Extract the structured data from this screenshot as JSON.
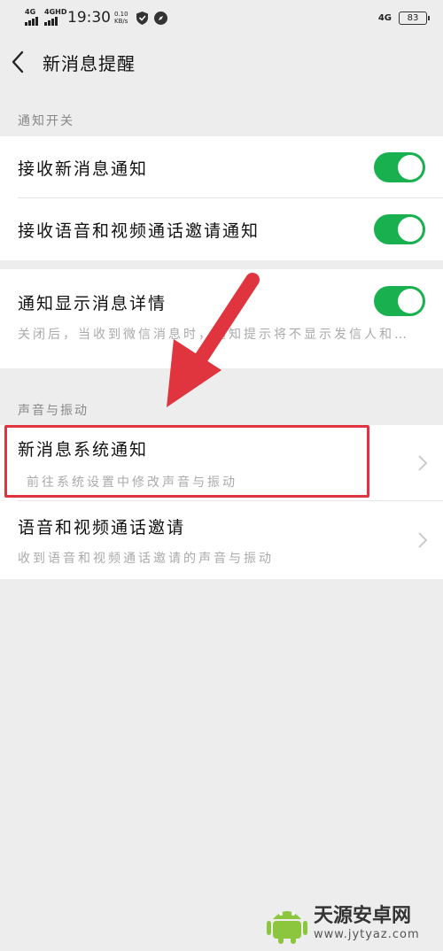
{
  "status_bar": {
    "sim1": "4G",
    "sim2": "4GHD",
    "time": "19:30",
    "speed_value": "0.10",
    "speed_unit": "KB/s",
    "network": "4G",
    "battery": "83"
  },
  "nav": {
    "title": "新消息提醒"
  },
  "notification_switch": {
    "label": "通知开关",
    "items": [
      {
        "title": "接收新消息通知",
        "enabled": true
      },
      {
        "title": "接收语音和视频通话邀请通知",
        "enabled": true
      }
    ]
  },
  "detail": {
    "title": "通知显示消息详情",
    "enabled": true,
    "subtitle": "关闭后，当收到微信消息时，通知提示将不显示发信人和…"
  },
  "sound_vibration": {
    "label": "声音与振动",
    "items": [
      {
        "title": "新消息系统通知",
        "subtitle": "前往系统设置中修改声音与振动"
      },
      {
        "title": "语音和视频通话邀请",
        "subtitle": "收到语音和视频通话邀请的声音与振动"
      }
    ]
  },
  "watermark": {
    "name": "天源安卓网",
    "url": "www.jytyaz.com"
  },
  "colors": {
    "toggle_on": "#19b14f",
    "highlight": "#e0353e",
    "background": "#ededed"
  }
}
